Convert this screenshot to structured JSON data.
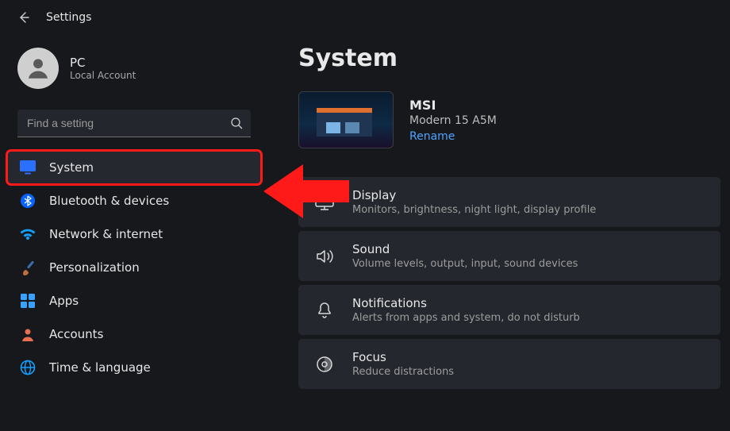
{
  "app": {
    "title": "Settings"
  },
  "account": {
    "name": "PC",
    "sub": "Local Account"
  },
  "search": {
    "placeholder": "Find a setting"
  },
  "sidebar": {
    "items": [
      {
        "label": "System"
      },
      {
        "label": "Bluetooth & devices"
      },
      {
        "label": "Network & internet"
      },
      {
        "label": "Personalization"
      },
      {
        "label": "Apps"
      },
      {
        "label": "Accounts"
      },
      {
        "label": "Time & language"
      }
    ]
  },
  "page": {
    "title": "System",
    "device": {
      "name": "MSI",
      "model": "Modern 15 A5M",
      "rename": "Rename"
    },
    "cards": [
      {
        "title": "Display",
        "sub": "Monitors, brightness, night light, display profile"
      },
      {
        "title": "Sound",
        "sub": "Volume levels, output, input, sound devices"
      },
      {
        "title": "Notifications",
        "sub": "Alerts from apps and system, do not disturb"
      },
      {
        "title": "Focus",
        "sub": "Reduce distractions"
      }
    ]
  },
  "colors": {
    "accent": "#4fa3ff",
    "annotation": "#ff1a1a"
  }
}
